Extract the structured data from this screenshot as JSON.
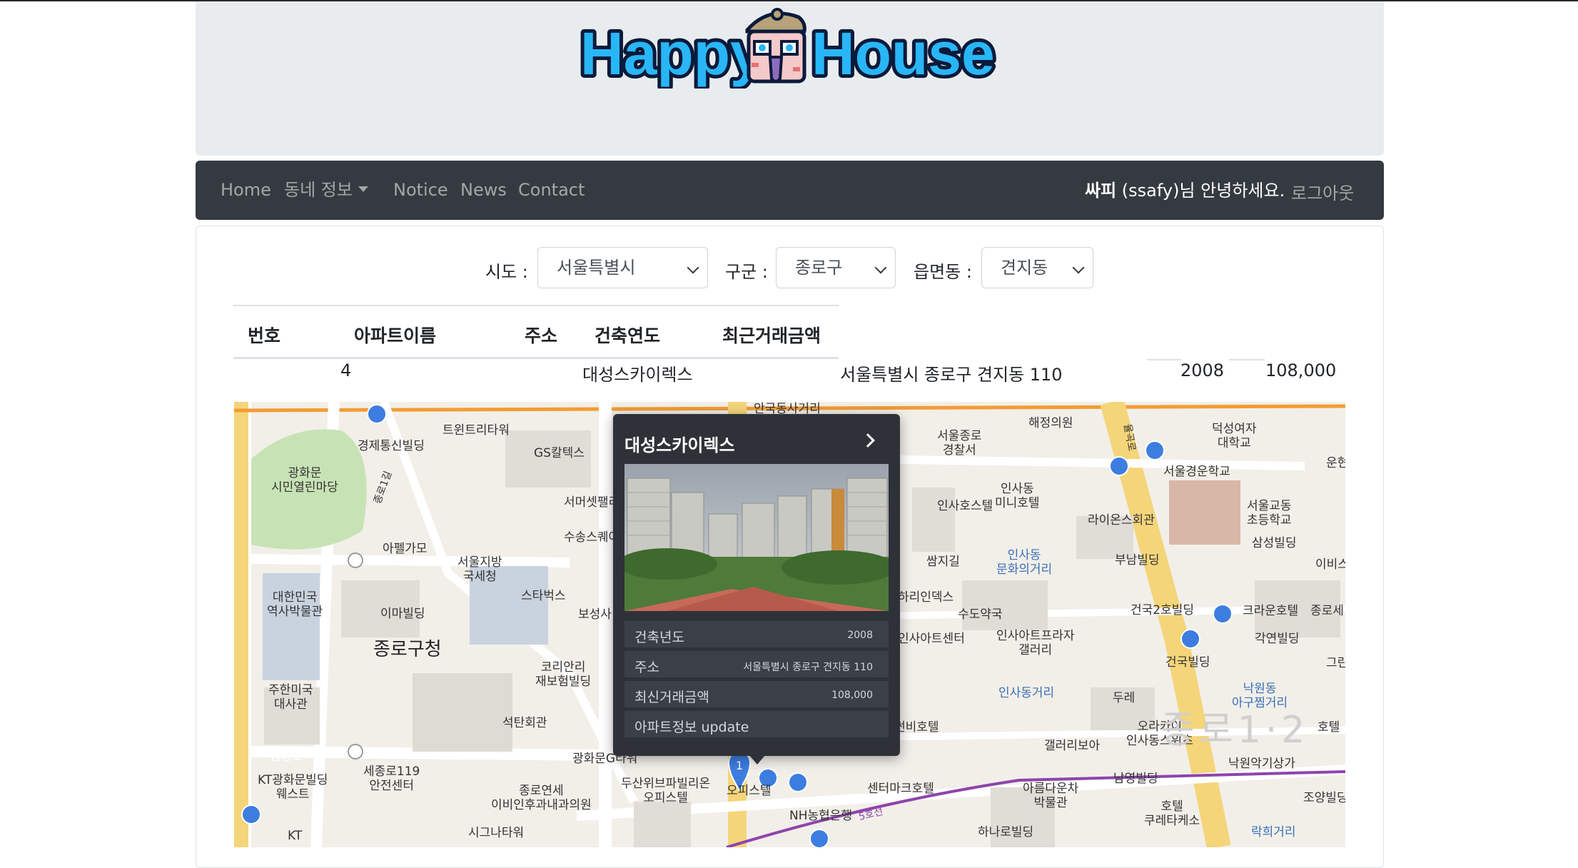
{
  "header": {
    "logo_text": "HappyHouse"
  },
  "nav": {
    "items": [
      {
        "label": "Home"
      },
      {
        "label": "동네 정보"
      },
      {
        "label": "Notice"
      },
      {
        "label": "News"
      },
      {
        "label": "Contact"
      }
    ],
    "user_name": "싸피",
    "user_suffix": " (ssafy)님 안녕하세요.",
    "logout_label": "로그아웃"
  },
  "filters": {
    "sido_label": "시도 :",
    "sido_value": "서울특별시",
    "gugun_label": "구군 :",
    "gugun_value": "종로구",
    "dong_label": "읍면동 :",
    "dong_value": "견지동"
  },
  "table": {
    "headers": [
      "번호",
      "아파트이름",
      "주소",
      "건축연도",
      "최근거래금액"
    ],
    "rows": [
      {
        "no": "4",
        "name": "대성스카이렉스",
        "address": "서울특별시 종로구 견지동 110",
        "year": "2008",
        "price": "108,000"
      }
    ]
  },
  "popup": {
    "title": "대성스카이렉스",
    "rows": [
      {
        "label": "건축년도",
        "value": "2008"
      },
      {
        "label": "주소",
        "value": "서울특별시 종로구 견지동 110"
      },
      {
        "label": "최신거래금액",
        "value": "108,000"
      },
      {
        "label": "아파트정보 update",
        "value": ""
      }
    ]
  },
  "map": {
    "marker_number": "1",
    "labels": [
      "트윈트리타워",
      "경제통신빌딩",
      "광화문\n시민열린마당",
      "GS칼텍스",
      "서머셋팰리",
      "아펠가모",
      "수송스퀘어",
      "서울지방\n국세청",
      "스타벅스",
      "보성사",
      "대한민국\n역사박물관",
      "이마빌딩",
      "종로구청",
      "코리안리\n재보험빌딩",
      "주한미국\n대사관",
      "석탄회관",
      "삼봉로",
      "세종로119\n안전센터",
      "KT광화문빌딩\n웨스트",
      "광화문G타워",
      "종로연세\n이비인후과내과의원",
      "두산위브파빌리온\n오피스텔",
      "오피스텔",
      "시그나타워",
      "NH농협은행",
      "KT",
      "안국동사거리",
      "서울종로\n경찰서",
      "해정의원",
      "덕성여자\n대학교",
      "서울경운학교",
      "인사호스텔",
      "인사동\n미니호텔",
      "라이온스회관",
      "서울교동\n초등학교",
      "쌈지길",
      "인사동\n문화의거리",
      "부남빌딩",
      "삼성빌딩",
      "이비스",
      "하리인덱스",
      "수도약국",
      "인사아트센터",
      "인사아트프라자\n갤러리",
      "건국2호빌딩",
      "크라운호텔",
      "종로세",
      "각연빌딩",
      "건국빌딩",
      "그린",
      "인사동거리",
      "두레",
      "낙원동\n아구찜거리",
      "썬비호텔",
      "갤러리보아",
      "오라카이\n인사동스위츠",
      "호텔",
      "센터마크호텔",
      "아름다운차\n박물관",
      "남영빌딩",
      "낙원악기상가",
      "조양빌딩",
      "호텔\n쿠레타케소",
      "하나로빌딩",
      "락희거리",
      "종로1·2",
      "운현",
      "율곡로",
      "종로1길",
      "5호선"
    ]
  }
}
